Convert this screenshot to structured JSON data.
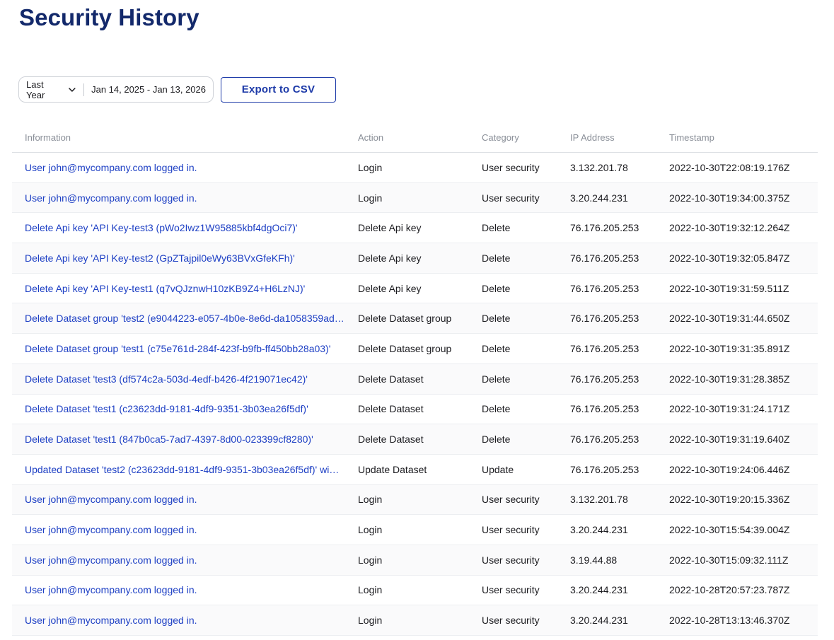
{
  "page": {
    "title": "Security History"
  },
  "toolbar": {
    "range_preset": "Last Year",
    "range_dates": "Jan 14, 2025 - Jan 13, 2026",
    "export_label": "Export to CSV"
  },
  "table": {
    "columns": [
      "Information",
      "Action",
      "Category",
      "IP Address",
      "Timestamp"
    ],
    "rows": [
      {
        "info": "User john@mycompany.com logged in.",
        "action": "Login",
        "category": "User security",
        "ip": "3.132.201.78",
        "timestamp": "2022-10-30T22:08:19.176Z"
      },
      {
        "info": "User john@mycompany.com logged in.",
        "action": "Login",
        "category": "User security",
        "ip": "3.20.244.231",
        "timestamp": "2022-10-30T19:34:00.375Z"
      },
      {
        "info": "Delete Api key 'API Key-test3 (pWo2Iwz1W95885kbf4dgOci7)'",
        "action": "Delete Api key",
        "category": "Delete",
        "ip": "76.176.205.253",
        "timestamp": "2022-10-30T19:32:12.264Z"
      },
      {
        "info": "Delete Api key 'API Key-test2 (GpZTajpil0eWy63BVxGfeKFh)'",
        "action": "Delete Api key",
        "category": "Delete",
        "ip": "76.176.205.253",
        "timestamp": "2022-10-30T19:32:05.847Z"
      },
      {
        "info": "Delete Api key 'API Key-test1 (q7vQJznwH10zKB9Z4+H6LzNJ)'",
        "action": "Delete Api key",
        "category": "Delete",
        "ip": "76.176.205.253",
        "timestamp": "2022-10-30T19:31:59.511Z"
      },
      {
        "info": "Delete Dataset group 'test2 (e9044223-e057-4b0e-8e6d-da1058359ad…",
        "action": "Delete Dataset group",
        "category": "Delete",
        "ip": "76.176.205.253",
        "timestamp": "2022-10-30T19:31:44.650Z"
      },
      {
        "info": "Delete Dataset group 'test1 (c75e761d-284f-423f-b9fb-ff450bb28a03)'",
        "action": "Delete Dataset group",
        "category": "Delete",
        "ip": "76.176.205.253",
        "timestamp": "2022-10-30T19:31:35.891Z"
      },
      {
        "info": "Delete Dataset 'test3 (df574c2a-503d-4edf-b426-4f219071ec42)'",
        "action": "Delete Dataset",
        "category": "Delete",
        "ip": "76.176.205.253",
        "timestamp": "2022-10-30T19:31:28.385Z"
      },
      {
        "info": "Delete Dataset 'test1 (c23623dd-9181-4df9-9351-3b03ea26f5df)'",
        "action": "Delete Dataset",
        "category": "Delete",
        "ip": "76.176.205.253",
        "timestamp": "2022-10-30T19:31:24.171Z"
      },
      {
        "info": "Delete Dataset 'test1 (847b0ca5-7ad7-4397-8d00-023399cf8280)'",
        "action": "Delete Dataset",
        "category": "Delete",
        "ip": "76.176.205.253",
        "timestamp": "2022-10-30T19:31:19.640Z"
      },
      {
        "info": "Updated Dataset 'test2 (c23623dd-9181-4df9-9351-3b03ea26f5df)' wi…",
        "action": "Update Dataset",
        "category": "Update",
        "ip": "76.176.205.253",
        "timestamp": "2022-10-30T19:24:06.446Z"
      },
      {
        "info": "User john@mycompany.com logged in.",
        "action": "Login",
        "category": "User security",
        "ip": "3.132.201.78",
        "timestamp": "2022-10-30T19:20:15.336Z"
      },
      {
        "info": "User john@mycompany.com logged in.",
        "action": "Login",
        "category": "User security",
        "ip": "3.20.244.231",
        "timestamp": "2022-10-30T15:54:39.004Z"
      },
      {
        "info": "User john@mycompany.com logged in.",
        "action": "Login",
        "category": "User security",
        "ip": "3.19.44.88",
        "timestamp": "2022-10-30T15:09:32.111Z"
      },
      {
        "info": "User john@mycompany.com logged in.",
        "action": "Login",
        "category": "User security",
        "ip": "3.20.244.231",
        "timestamp": "2022-10-28T20:57:23.787Z"
      },
      {
        "info": "User john@mycompany.com logged in.",
        "action": "Login",
        "category": "User security",
        "ip": "3.20.244.231",
        "timestamp": "2022-10-28T13:13:46.370Z"
      }
    ]
  }
}
